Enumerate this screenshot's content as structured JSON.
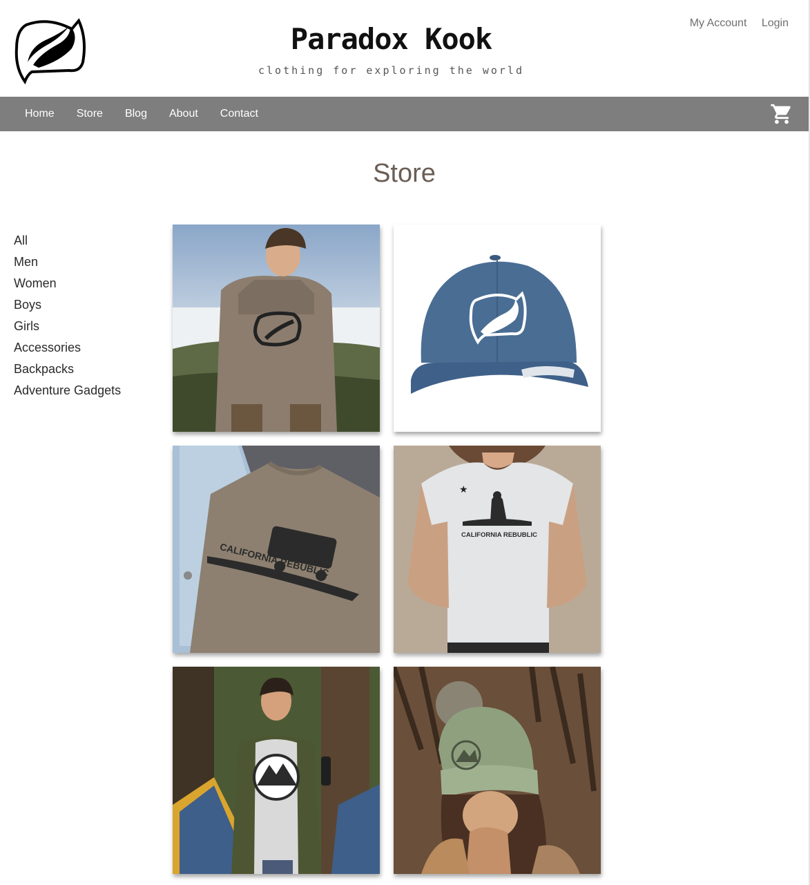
{
  "header": {
    "title": "Paradox Kook",
    "tagline": "clothing for exploring the world",
    "my_account": "My Account",
    "login": "Login"
  },
  "nav": {
    "items": [
      {
        "label": "Home"
      },
      {
        "label": "Store"
      },
      {
        "label": "Blog"
      },
      {
        "label": "About"
      },
      {
        "label": "Contact"
      }
    ],
    "cart_icon": "shopping-cart-icon"
  },
  "main": {
    "heading": "Store",
    "categories": [
      {
        "label": "All"
      },
      {
        "label": "Men"
      },
      {
        "label": "Women"
      },
      {
        "label": "Boys"
      },
      {
        "label": "Girls"
      },
      {
        "label": "Accessories"
      },
      {
        "label": "Backpacks"
      },
      {
        "label": "Adventure Gadgets"
      }
    ],
    "products": [
      {
        "name": "hoodie-man-mountain"
      },
      {
        "name": "blue-trucker-cap"
      },
      {
        "name": "tshirt-california-rebublic-bus",
        "print_text": "CALIFORNIA REBUBLIC"
      },
      {
        "name": "tshirt-california-rebublic-bigfoot",
        "print_text": "CALIFORNIA REBUBLIC"
      },
      {
        "name": "tshirt-mountain-man-tent"
      },
      {
        "name": "green-beanie-woman"
      }
    ]
  },
  "colors": {
    "nav_bg": "#7e7e7e",
    "heading": "#6b5d55",
    "account_link": "#6f6f6f",
    "cap_blue": "#4a6d94"
  }
}
